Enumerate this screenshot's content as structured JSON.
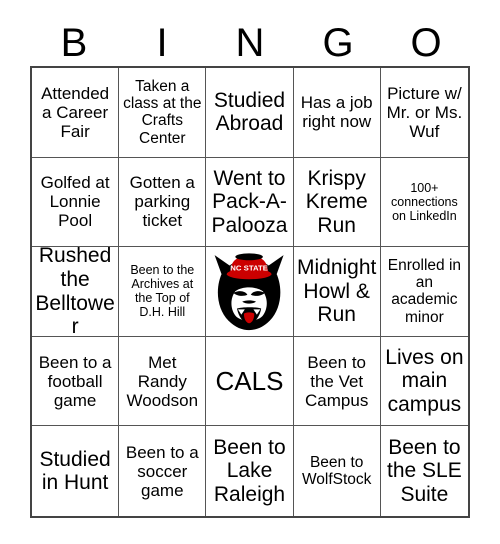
{
  "header": {
    "letters": [
      "B",
      "I",
      "N",
      "G",
      "O"
    ]
  },
  "colors": {
    "grid_line": "#555555",
    "outer_border": "#444444",
    "background": "#ffffff",
    "text": "#000000",
    "logo_red": "#CC0000",
    "logo_black": "#000000",
    "logo_white": "#ffffff"
  },
  "grid": {
    "columns": 5,
    "rows": 5,
    "cells": [
      {
        "text": "Attended a Career Fair",
        "size": "fs-lg",
        "type": "text"
      },
      {
        "text": "Taken a class at the Crafts Center",
        "size": "fs-md",
        "type": "text"
      },
      {
        "text": "Studied Abroad",
        "size": "fs-xl",
        "type": "text"
      },
      {
        "text": "Has a job right now",
        "size": "fs-lg",
        "type": "text"
      },
      {
        "text": "Picture w/ Mr. or Ms. Wuf",
        "size": "fs-lg",
        "type": "text"
      },
      {
        "text": "Golfed at Lonnie Pool",
        "size": "fs-lg",
        "type": "text"
      },
      {
        "text": "Gotten a parking ticket",
        "size": "fs-lg",
        "type": "text"
      },
      {
        "text": "Went to Pack-A-Palooza",
        "size": "fs-xl",
        "type": "text"
      },
      {
        "text": "Krispy Kreme Run",
        "size": "fs-xl",
        "type": "text"
      },
      {
        "text": "100+ connections on LinkedIn",
        "size": "fs-sm",
        "type": "text"
      },
      {
        "text": "Rushed the Belltower",
        "size": "fs-xl",
        "type": "text"
      },
      {
        "text": "Been to the Archives at the Top of D.H. Hill",
        "size": "fs-sm",
        "type": "text"
      },
      {
        "text": "",
        "size": "fs-md",
        "type": "logo",
        "logo_name": "nc-state-tuffy-wolf-logo",
        "logo_hat_text": "NC STATE"
      },
      {
        "text": "Midnight Howl & Run",
        "size": "fs-xl",
        "type": "text"
      },
      {
        "text": "Enrolled in an academic minor",
        "size": "fs-md",
        "type": "text"
      },
      {
        "text": "Been to a football game",
        "size": "fs-lg",
        "type": "text"
      },
      {
        "text": "Met Randy Woodson",
        "size": "fs-lg",
        "type": "text"
      },
      {
        "text": "CALS",
        "size": "fs-huge",
        "type": "text"
      },
      {
        "text": "Been to the Vet Campus",
        "size": "fs-lg",
        "type": "text"
      },
      {
        "text": "Lives on main campus",
        "size": "fs-xl",
        "type": "text"
      },
      {
        "text": "Studied in Hunt",
        "size": "fs-xl",
        "type": "text"
      },
      {
        "text": "Been to a soccer game",
        "size": "fs-lg",
        "type": "text"
      },
      {
        "text": "Been to Lake Raleigh",
        "size": "fs-xl",
        "type": "text"
      },
      {
        "text": "Been to WolfStock",
        "size": "fs-md",
        "type": "text"
      },
      {
        "text": "Been to the SLE Suite",
        "size": "fs-xl",
        "type": "text"
      }
    ]
  }
}
